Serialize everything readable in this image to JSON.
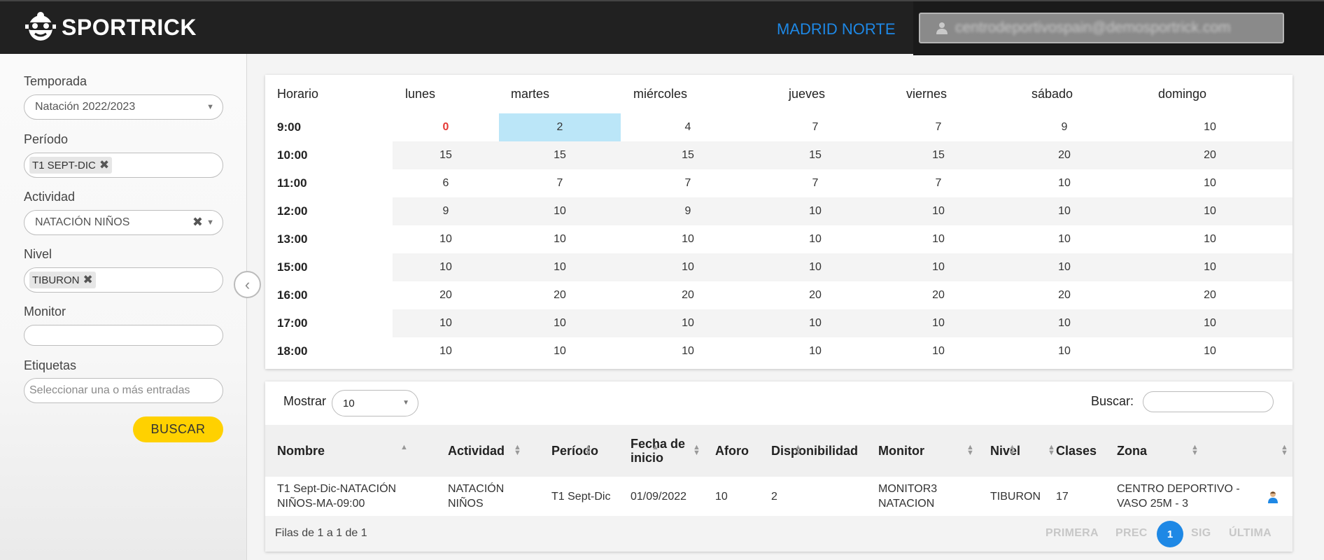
{
  "header": {
    "logo_text": "SPORTRICK",
    "center_name": "MADRID NORTE",
    "user_email": "centrodeportivospain@demosportrick.com"
  },
  "filters": {
    "temporada": {
      "label": "Temporada",
      "value": "Natación 2022/2023"
    },
    "periodo": {
      "label": "Período",
      "tag": "T1 SEPT-DIC"
    },
    "actividad": {
      "label": "Actividad",
      "value": "NATACIÓN NIÑOS"
    },
    "nivel": {
      "label": "Nivel",
      "tag": "TIBURON"
    },
    "monitor": {
      "label": "Monitor",
      "value": ""
    },
    "etiquetas": {
      "label": "Etiquetas",
      "placeholder": "Seleccionar una o más entradas"
    },
    "search_button": "BUSCAR"
  },
  "schedule": {
    "time_header": "Horario",
    "days": [
      "lunes",
      "martes",
      "miércoles",
      "jueves",
      "viernes",
      "sábado",
      "domingo"
    ],
    "rows": [
      {
        "time": "9:00",
        "values": [
          "0",
          "2",
          "4",
          "7",
          "7",
          "9",
          "10"
        ]
      },
      {
        "time": "10:00",
        "values": [
          "15",
          "15",
          "15",
          "15",
          "15",
          "20",
          "20"
        ]
      },
      {
        "time": "11:00",
        "values": [
          "6",
          "7",
          "7",
          "7",
          "7",
          "10",
          "10"
        ]
      },
      {
        "time": "12:00",
        "values": [
          "9",
          "10",
          "9",
          "10",
          "10",
          "10",
          "10"
        ]
      },
      {
        "time": "13:00",
        "values": [
          "10",
          "10",
          "10",
          "10",
          "10",
          "10",
          "10"
        ]
      },
      {
        "time": "15:00",
        "values": [
          "10",
          "10",
          "10",
          "10",
          "10",
          "10",
          "10"
        ]
      },
      {
        "time": "16:00",
        "values": [
          "20",
          "20",
          "20",
          "20",
          "20",
          "20",
          "20"
        ]
      },
      {
        "time": "17:00",
        "values": [
          "10",
          "10",
          "10",
          "10",
          "10",
          "10",
          "10"
        ]
      },
      {
        "time": "18:00",
        "values": [
          "10",
          "10",
          "10",
          "10",
          "10",
          "10",
          "10"
        ]
      }
    ],
    "highlight_color": "#bbe6f8",
    "zero_color": "#e53935"
  },
  "list": {
    "show_label": "Mostrar",
    "show_value": "10",
    "search_label": "Buscar:",
    "columns": [
      "Nombre",
      "Actividad",
      "Período",
      "Fecha de inicio",
      "Aforo",
      "Disponibilidad",
      "Monitor",
      "Nivel",
      "Clases",
      "Zona"
    ],
    "row": {
      "nombre": "T1 Sept-Dic-NATACIÓN NIÑOS-MA-09:00",
      "actividad": "NATACIÓN NIÑOS",
      "periodo": "T1 Sept-Dic",
      "fecha": "01/09/2022",
      "aforo": "10",
      "disponibilidad": "2",
      "monitor": "MONITOR3 NATACION",
      "nivel": "TIBURON",
      "clases": "17",
      "zona": "CENTRO DEPORTIVO - VASO 25M - 3"
    },
    "footer_info": "Filas de 1 a 1 de 1",
    "pagination": {
      "first": "PRIMERA",
      "prev": "PREC",
      "current": "1",
      "next": "SIG",
      "last": "ÚLTIMA"
    }
  },
  "colors": {
    "accent": "#1e88e5",
    "button": "#ffd100",
    "header_bg": "#212121"
  }
}
